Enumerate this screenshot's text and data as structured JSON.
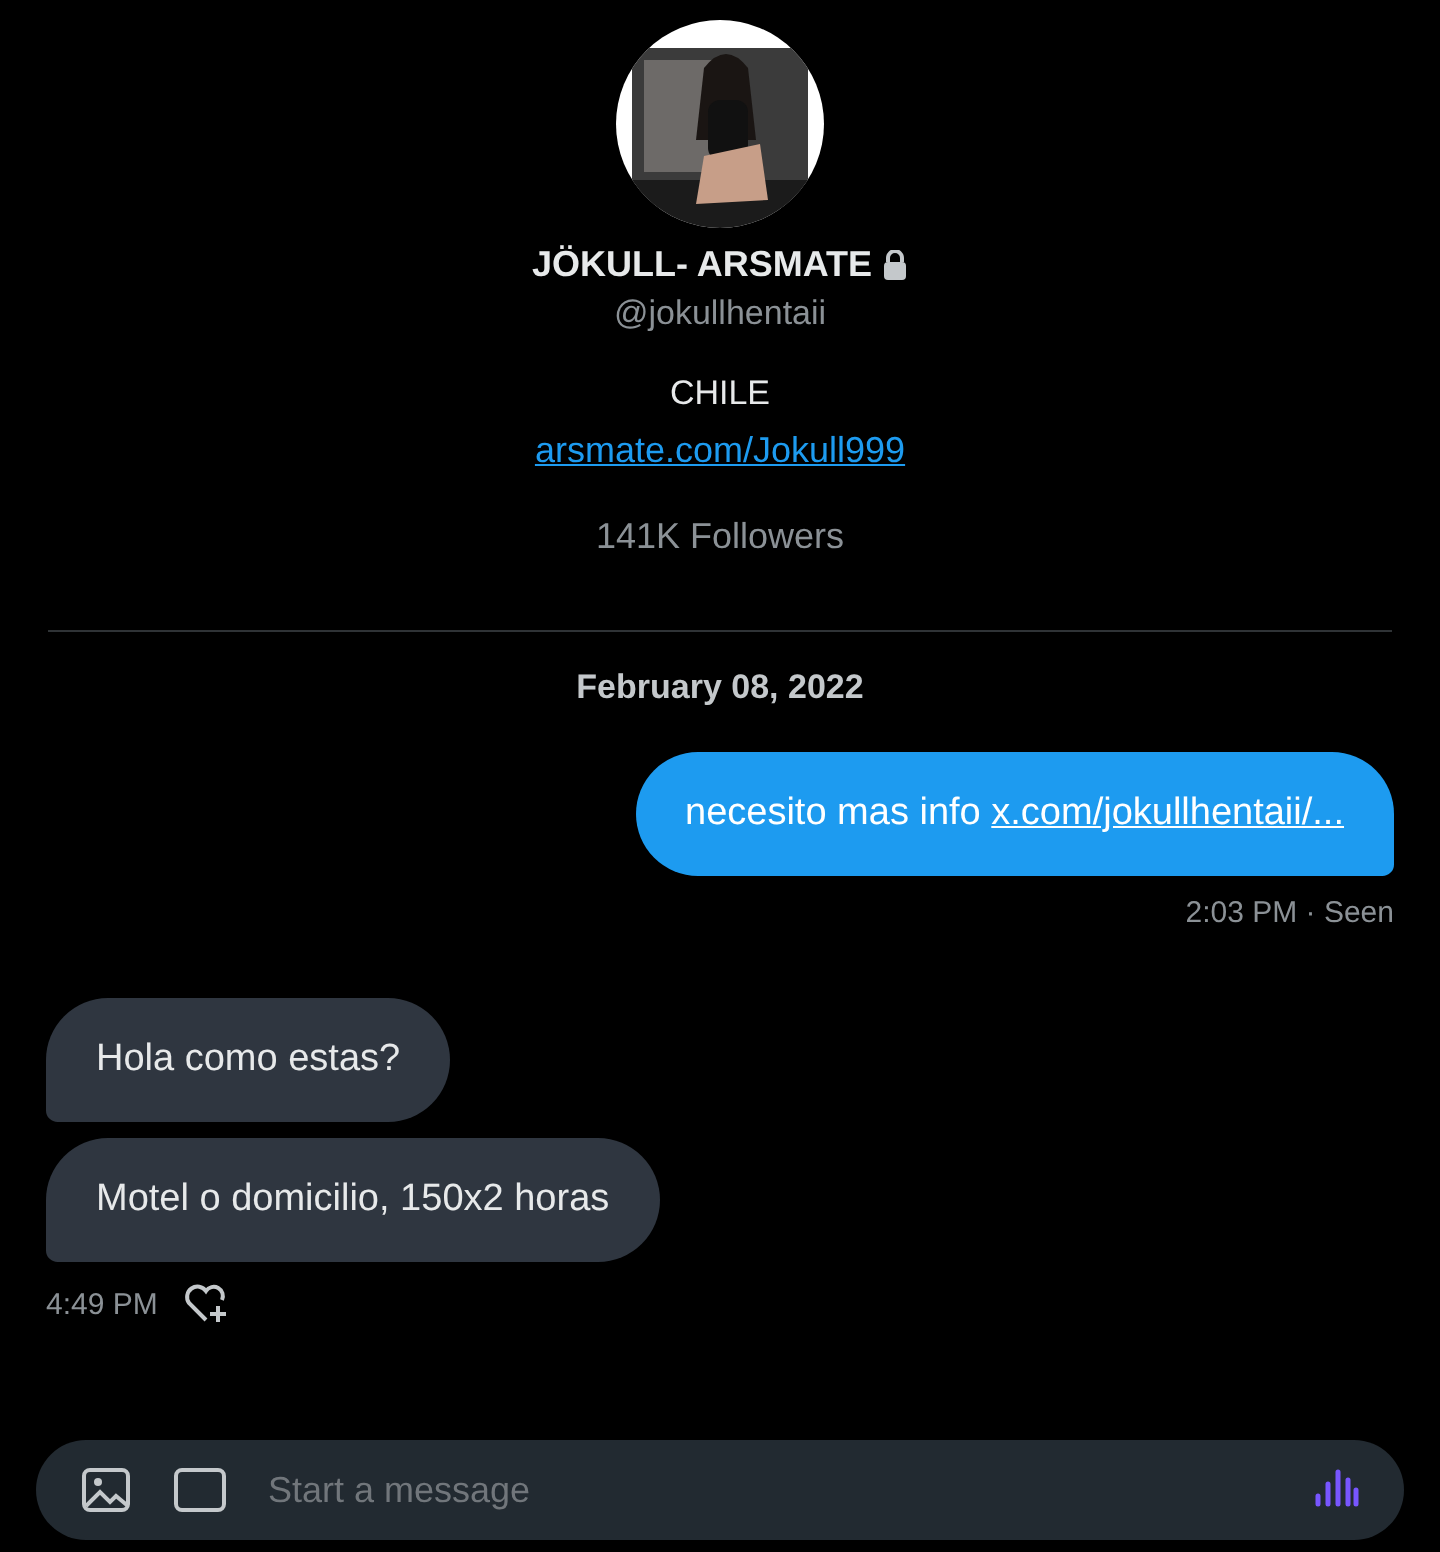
{
  "profile": {
    "name": "JÖKULL- ARSMATE",
    "protected": true,
    "handle": "@jokullhentaii",
    "location": "CHILE",
    "link": "arsmate.com/Jokull999",
    "followers": "141K Followers"
  },
  "date": "February 08, 2022",
  "messages": [
    {
      "kind": "sent",
      "parts": [
        {
          "kind": "text",
          "text": "necesito mas info "
        },
        {
          "kind": "link",
          "text": "x.com/jokullhentaii/..."
        }
      ],
      "meta": "2:03 PM · Seen"
    },
    {
      "kind": "received",
      "parts": [
        {
          "kind": "text",
          "text": "Hola como estas?"
        }
      ]
    },
    {
      "kind": "received",
      "parts": [
        {
          "kind": "text",
          "text": "Motel o domicilio, 150x2 horas"
        }
      ],
      "meta": "4:49 PM"
    }
  ],
  "composer": {
    "placeholder": "Start a message"
  }
}
